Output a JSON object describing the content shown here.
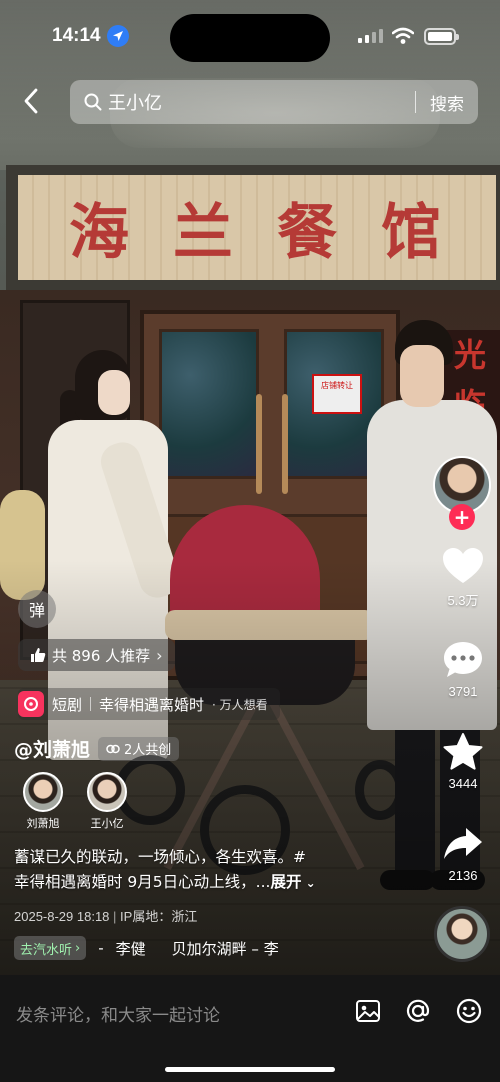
{
  "status_bar": {
    "time": "14:14"
  },
  "search": {
    "query": "王小亿",
    "button_label": "搜索"
  },
  "scene": {
    "shop_sign": [
      "海",
      "兰",
      "餐",
      "馆"
    ],
    "door_notice": "店铺转让",
    "side_sign": "光\n临"
  },
  "rail": {
    "likes": "5.3万",
    "comments": "3791",
    "favorites": "3444",
    "shares": "2136",
    "follow_label": "+"
  },
  "overlay": {
    "danmu_label": "弹",
    "recommend_label": "共 896 人推荐",
    "drama_label": "短剧",
    "drama_title": "幸得相遇离婚时",
    "drama_sub": "· 万人想看",
    "author_name": "@刘萧旭",
    "co_creators_label": "2人共创",
    "creators": [
      {
        "name": "刘萧旭"
      },
      {
        "name": "王小亿"
      }
    ],
    "caption_line1": "蓄谋已久的联动，一场倾心，各生欢喜。#",
    "caption_line2": "幸得相遇离婚时 9月5日心动上线，...",
    "expand_label": "展开",
    "date": "2025-8-29 18:18",
    "ip_location": "IP属地：浙江",
    "music_tag": "去汽水听",
    "music_artist": "李健",
    "music_song": "贝加尔湖畔 – 李"
  },
  "bottom_bar": {
    "comment_placeholder": "发条评论，和大家一起讨论"
  },
  "colors": {
    "accent": "#fe2c55",
    "location_blue": "#2f7df6",
    "bottom_bg": "#161616"
  }
}
